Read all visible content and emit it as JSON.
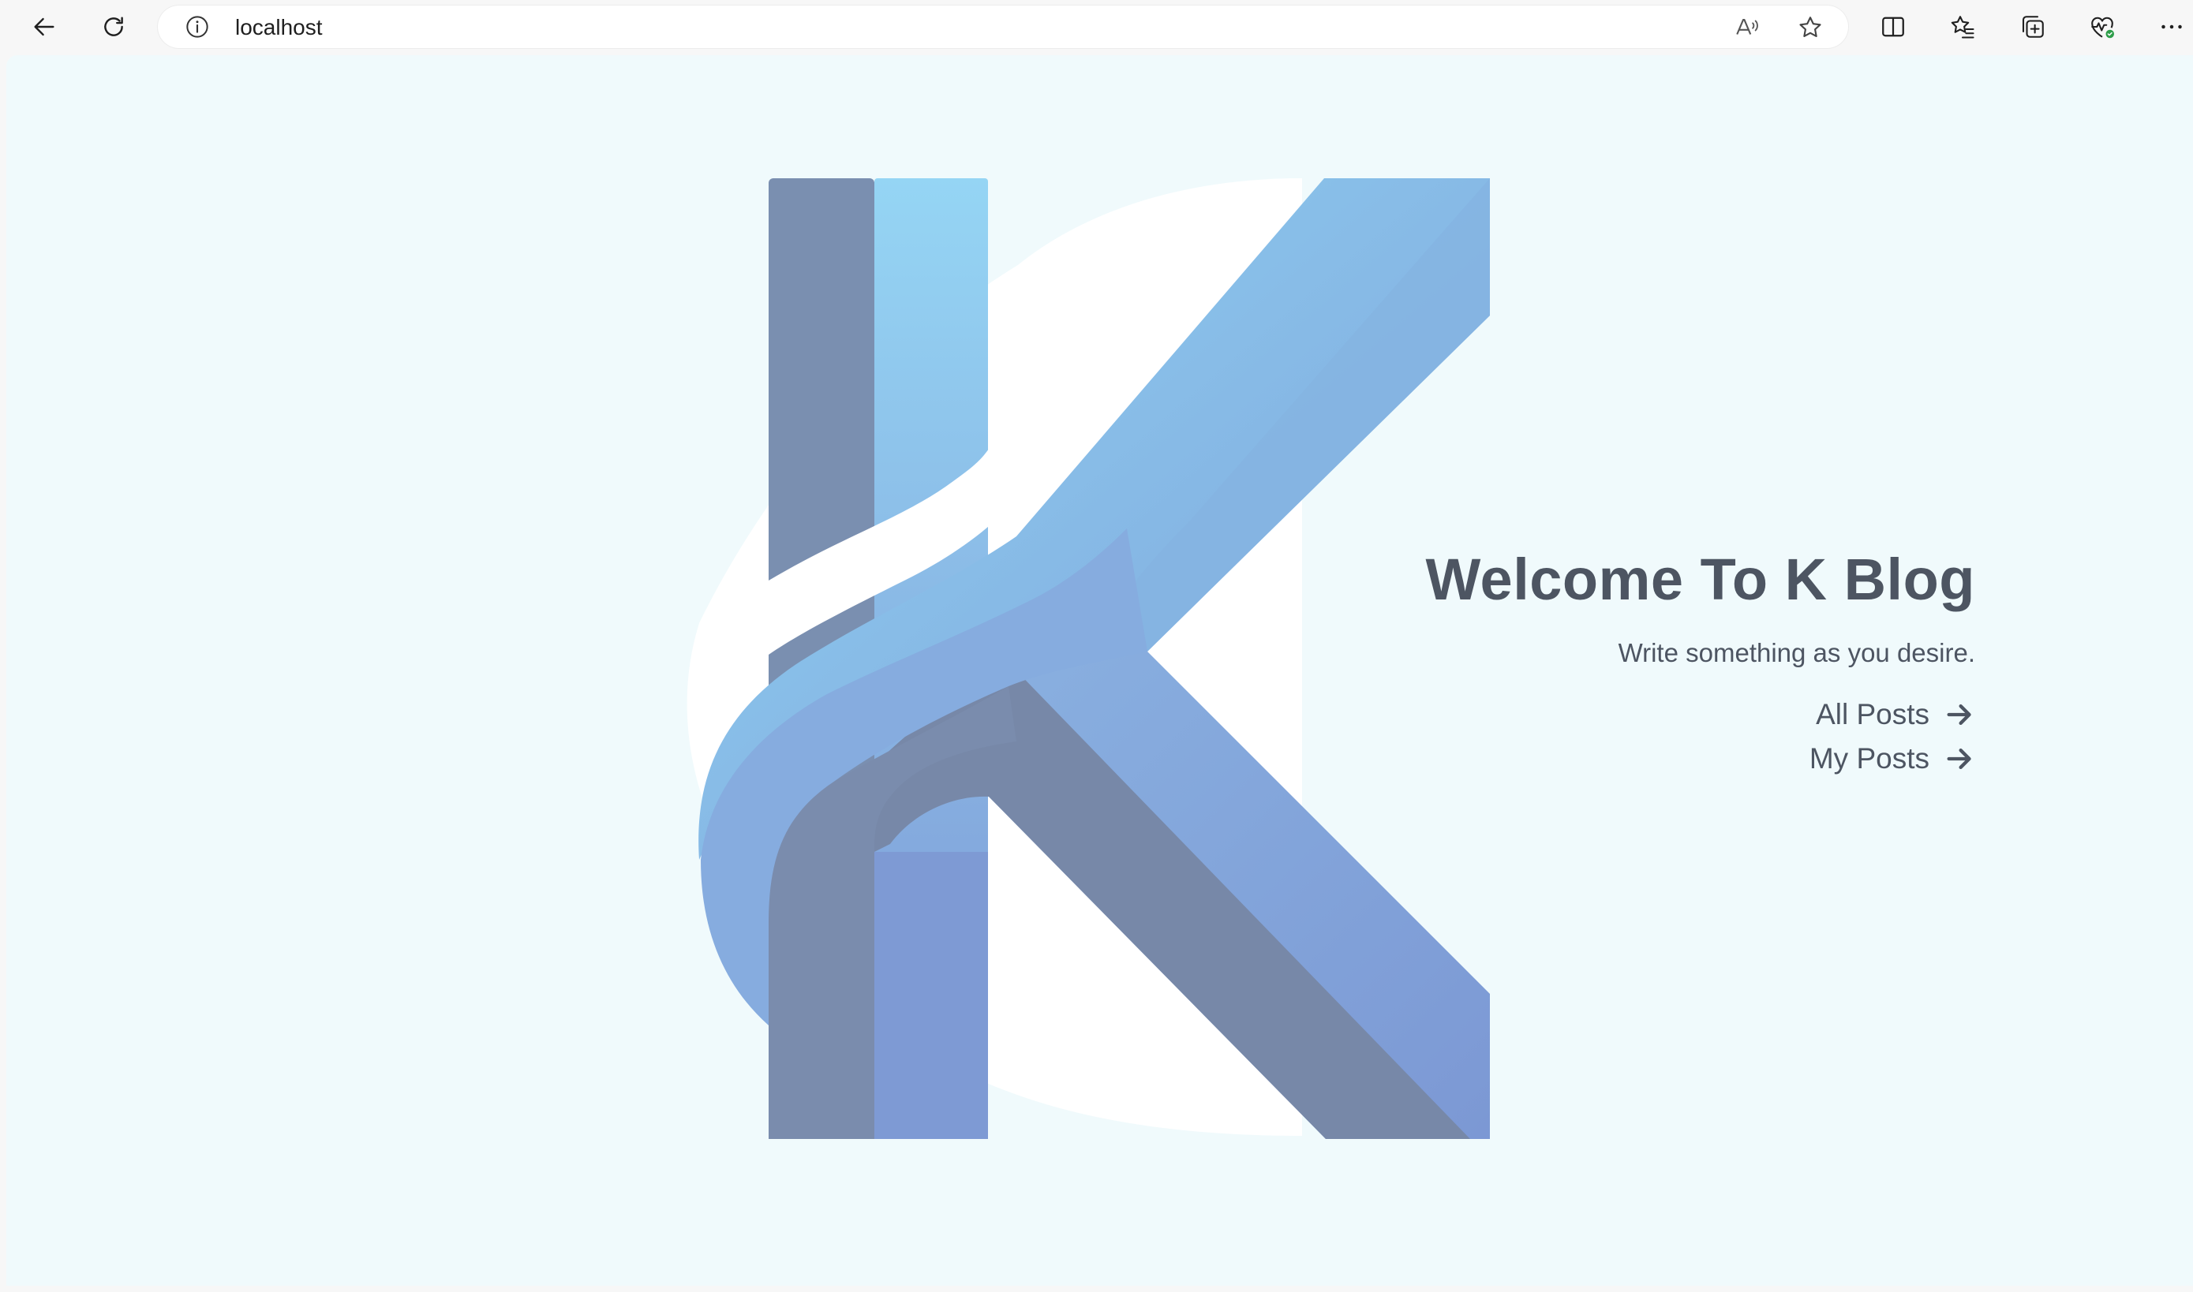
{
  "browser": {
    "url": "localhost",
    "icons": {
      "back": "arrow-left-icon",
      "refresh": "refresh-icon",
      "info": "info-icon",
      "read_aloud": "read-aloud-icon",
      "favorite": "star-icon",
      "split_screen": "split-screen-icon",
      "favorites": "favorites-list-icon",
      "collections": "collections-icon",
      "performance": "heart-pulse-icon",
      "more": "more-icon"
    }
  },
  "hero": {
    "title": "Welcome To K Blog",
    "subtitle": "Write something as you desire.",
    "links": [
      {
        "label": "All Posts"
      },
      {
        "label": "My Posts"
      }
    ]
  },
  "colors": {
    "page_background": "#f0fafc",
    "text": "#4d5562",
    "logo_light": "#8fd0f0",
    "logo_mid": "#7fa6dc",
    "logo_dark": "#7788a8"
  }
}
